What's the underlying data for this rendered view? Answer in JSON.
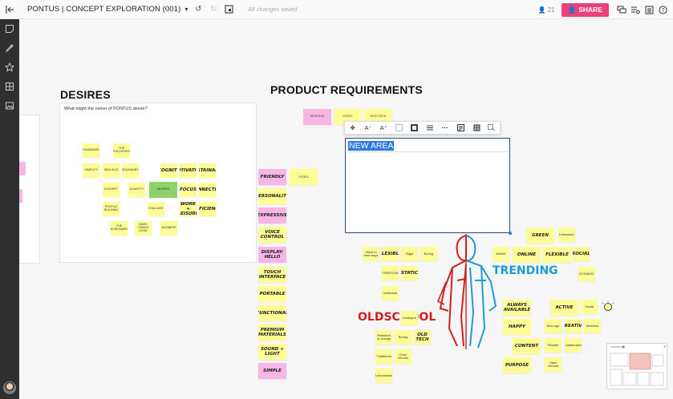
{
  "topbar": {
    "title": "PONTUS | CONCEPT EXPLORATION (001)",
    "save_status": "All changes saved",
    "user_count": "21",
    "share_label": "SHARE"
  },
  "canvas": {
    "desires": {
      "heading": "DESIRES",
      "subtitle": "What might the owner of PONTUS desire?",
      "notes": [
        "HANDMADE",
        "THE PHILOSOPHY",
        "SIMPLIFY",
        "SIDE KICK",
        "BOUNDARY",
        "RECOGNITION",
        "MOTIVATION",
        "SUSTAINABLE",
        "EXCERPT",
        "QUANTITY",
        "DESIRES",
        "FOCUS",
        "CONNECTION",
        "PROFILE BUILDING",
        "EVALUATE",
        "WORK + LEISURE",
        "EFFICIENCY",
        "THE ENVIRONMENT",
        "MAKE THINGS DONE",
        "BUSINESS"
      ]
    },
    "product_requirements": {
      "heading": "PRODUCT REQUIREMENTS",
      "top_notes": [
        "INTUITIVE",
        "STATIC",
        "HIGH TECH"
      ],
      "column_notes": [
        "FRIENDLY",
        "FIXED",
        "PERSONALITY",
        "EXPRESSIVE",
        "VOICE CONTROL",
        "DISPLAY: HELLO",
        "TOUCH INTERFACE",
        "PORTABLE",
        "FUNCTIONAL",
        "PREMIUM MATERIALS",
        "SOUND + LIGHT",
        "SIMPLE"
      ]
    },
    "text_box": {
      "value": "NEW AREA"
    },
    "oldschool": {
      "label": "OLDSCHOOL",
      "notes": [
        "Stuck in their ways",
        "FLEXIBLE",
        "Rigid",
        "Boring",
        "FREEDOM",
        "STATIC",
        "Individual",
        "Analogue",
        "Resistant to change",
        "Boring",
        "OLD TECH",
        "Traditional",
        "Close minded",
        "Unavailable"
      ]
    },
    "trending": {
      "label": "TRENDING",
      "notes": [
        "GREEN",
        "Interactive",
        "Mobile",
        "ONLINE",
        "FLEXIBLE",
        "SOCIAL",
        "DYNAMIC",
        "ALWAYS AVAILABLE",
        "ACTIVE",
        "Social",
        "HAPPY",
        "New age",
        "CREATIVE",
        "Wireless",
        "CONTENT",
        "Flexible",
        "Collaborative",
        "PURPOSE",
        "Open minded"
      ]
    }
  }
}
